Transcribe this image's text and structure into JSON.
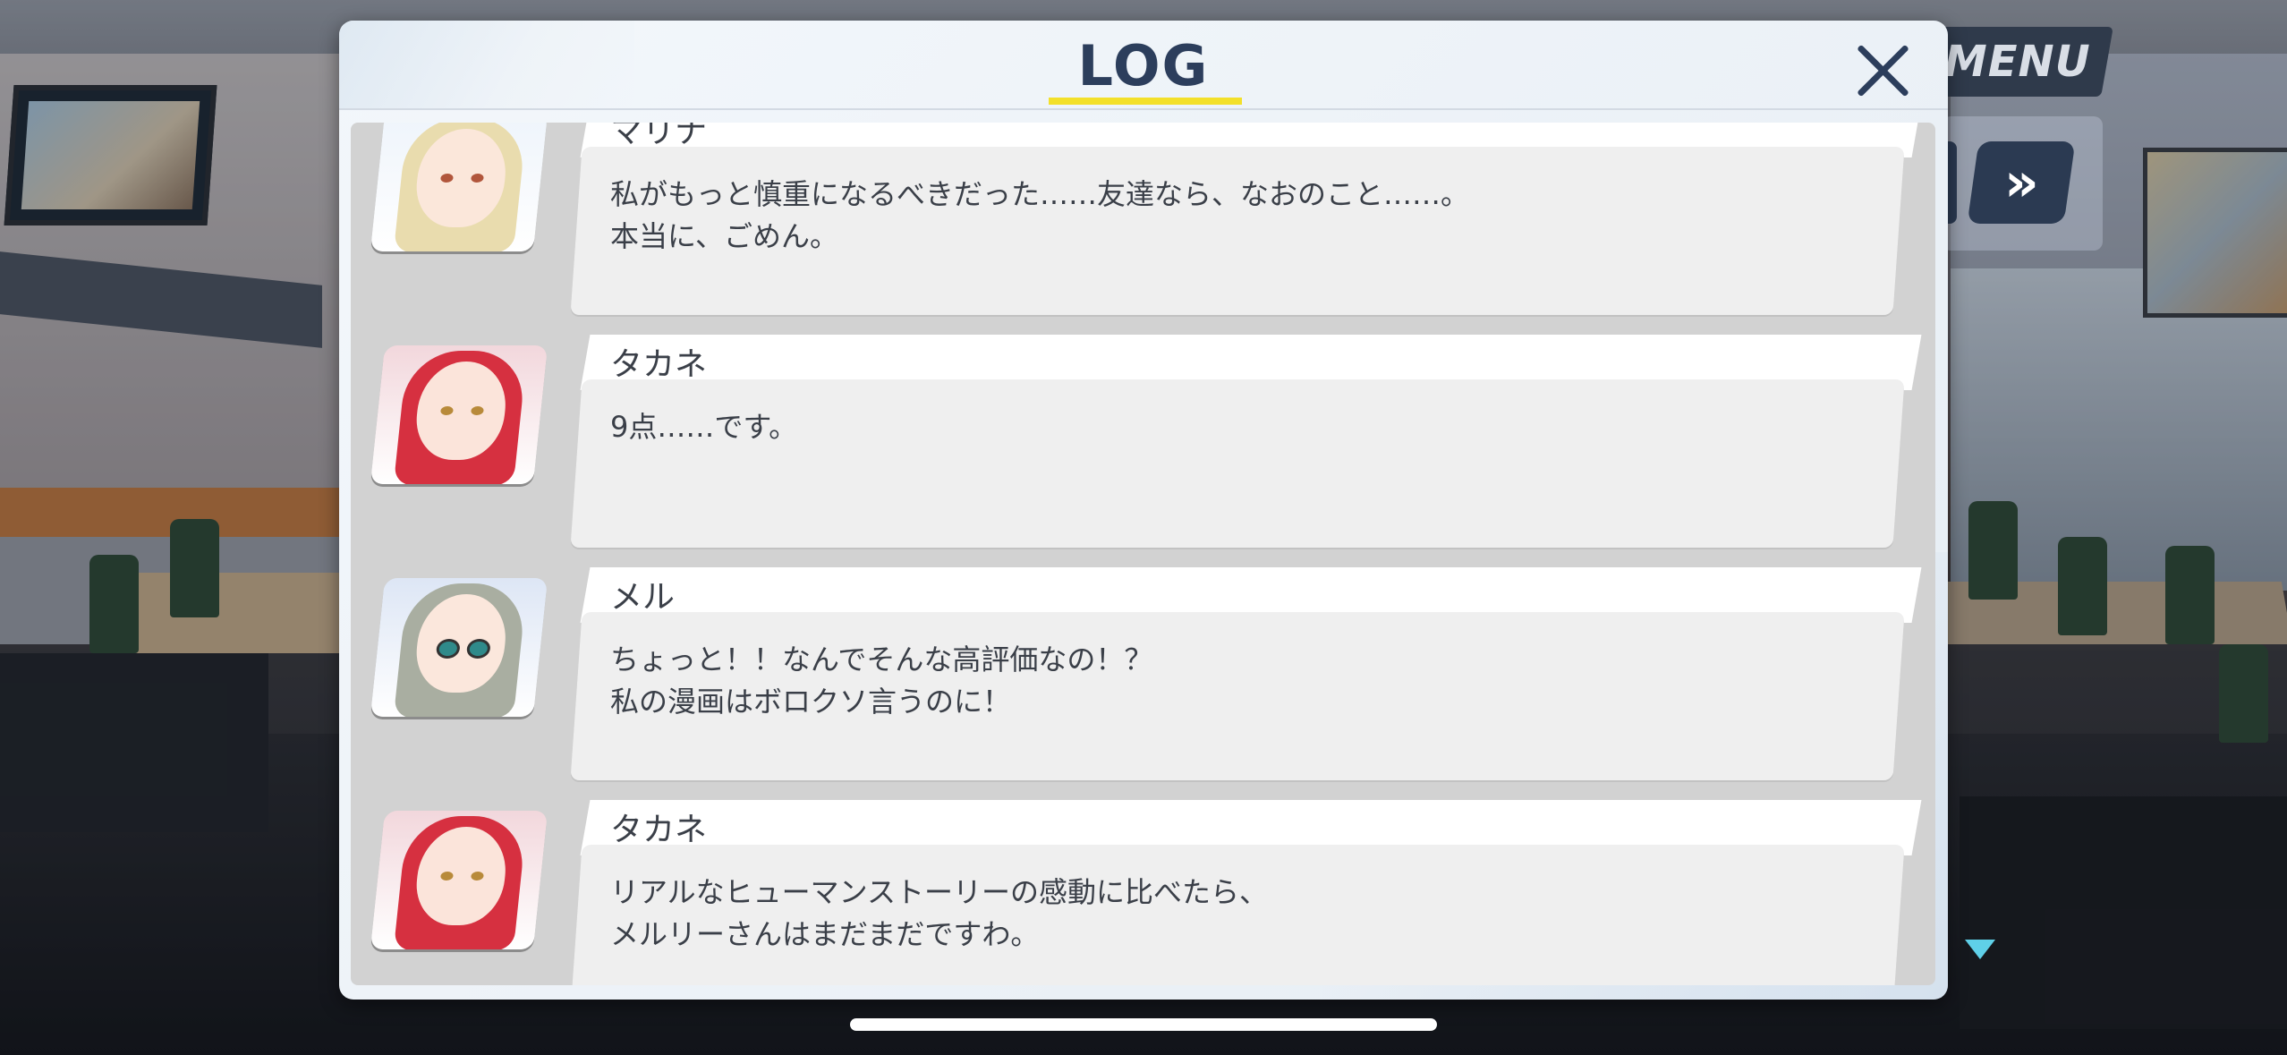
{
  "hud": {
    "menu_label": "MENU",
    "fast_forward_label": "»"
  },
  "dialog": {
    "title": "LOG"
  },
  "log_entries": [
    {
      "speaker": "マリナ",
      "line1": "私がもっと慎重になるべきだった……友達なら、なおのこと……。",
      "line2": "本当に、ごめん。",
      "portrait": "marina-portrait"
    },
    {
      "speaker": "タカネ",
      "line1": "9点……です。",
      "line2": "",
      "portrait": "takane-portrait"
    },
    {
      "speaker": "メル",
      "line1": "ちょっと！！なんでそんな高評価なの！？",
      "line2": "私の漫画はボロクソ言うのに！",
      "portrait": "meru-portrait"
    },
    {
      "speaker": "タカネ",
      "line1": "リアルなヒューマンストーリーの感動に比べたら、",
      "line2": "メルリーさんはまだまだですわ。",
      "portrait": "takane-portrait"
    }
  ],
  "colors": {
    "title": "#2c3e5c",
    "underline": "#f3e02a",
    "text": "#3a3f48",
    "next_marker": "#5fd0e8"
  }
}
